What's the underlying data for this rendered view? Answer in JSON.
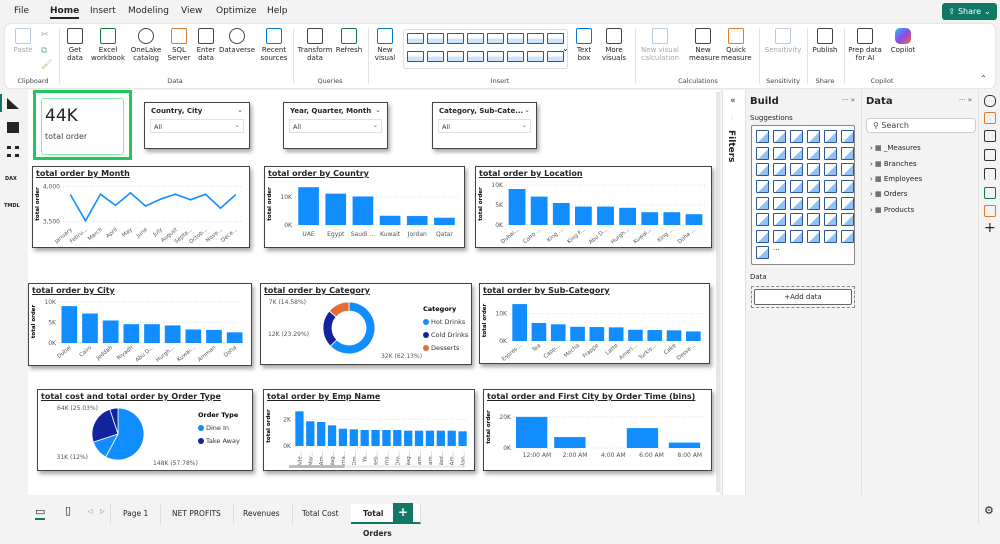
{
  "menu": {
    "file": "File",
    "home": "Home",
    "insert": "Insert",
    "modeling": "Modeling",
    "view": "View",
    "optimize": "Optimize",
    "help": "Help",
    "share": "Share"
  },
  "ribbon": {
    "paste": "Paste",
    "clipboard": "Clipboard",
    "get_data": "Get data",
    "excel": "Excel workbook",
    "onelake": "OneLake catalog",
    "sql": "SQL Server",
    "enter_data": "Enter data",
    "dataverse": "Dataverse",
    "recent": "Recent sources",
    "data_group": "Data",
    "transform": "Transform data",
    "refresh": "Refresh",
    "queries": "Queries",
    "new_visual": "New visual",
    "text_box": "Text box",
    "more_visuals": "More visuals",
    "insert_group": "Insert",
    "new_visual_calc": "New visual calculation",
    "new_measure": "New measure",
    "quick_measure": "Quick measure",
    "calculations": "Calculations",
    "sensitivity": "Sensitivity",
    "sensitivity_group": "Sensitivity",
    "publish": "Publish",
    "share_group": "Share",
    "prep_ai": "Prep data for AI",
    "copilot": "Copilot",
    "copilot_group": "Copilot"
  },
  "kpi": {
    "value": "44K",
    "label": "total order"
  },
  "slicers": [
    {
      "title": "Country, City",
      "value": "All"
    },
    {
      "title": "Year, Quarter, Month",
      "value": "All"
    },
    {
      "title": "Category, Sub-Cate...",
      "value": "All"
    }
  ],
  "colors": {
    "bar": "#118DFF",
    "navy": "#12239E",
    "orange": "#E66C37",
    "accent": "#117865",
    "kpi_border": "#22C55E"
  },
  "chart_data": [
    {
      "id": "month",
      "type": "line",
      "title": "total order by Month",
      "ylabel": "total order",
      "categories": [
        "January",
        "Febru...",
        "March",
        "April",
        "May",
        "June",
        "July",
        "August",
        "Septe...",
        "Octob...",
        "Nove...",
        "Dece..."
      ],
      "values": [
        3880,
        3510,
        3890,
        3730,
        3910,
        3720,
        3820,
        3890,
        3810,
        3890,
        3690,
        3880
      ],
      "ylim": [
        3450,
        4050
      ],
      "yticks": [
        "3,500",
        "4,000"
      ],
      "ytick_values": [
        3500,
        4000
      ]
    },
    {
      "id": "country",
      "type": "bar",
      "title": "total order by Country",
      "ylabel": "total order",
      "categories": [
        "UAE",
        "Egypt",
        "Saudi ...",
        "Kuwait",
        "Jordan",
        "Qatar"
      ],
      "values": [
        13500,
        11200,
        10200,
        3300,
        3200,
        2600
      ],
      "ylim": [
        0,
        15000
      ],
      "yticks": [
        "0K",
        "10K"
      ],
      "ytick_values": [
        0,
        10000
      ]
    },
    {
      "id": "location",
      "type": "bar",
      "title": "total order by Location",
      "ylabel": "total order",
      "categories": [
        "Dubai...",
        "Cairo ...",
        "King ...",
        "King F...",
        "Abu D...",
        "Hurgh...",
        "Kuwai...",
        "King ...",
        "Doha ..."
      ],
      "values": [
        9000,
        7100,
        5500,
        4600,
        4600,
        4300,
        3200,
        3200,
        2700
      ],
      "ylim": [
        0,
        10500
      ],
      "yticks": [
        "0K",
        "5K",
        "10K"
      ],
      "ytick_values": [
        0,
        5000,
        10000
      ]
    },
    {
      "id": "city",
      "type": "bar",
      "title": "total order by City",
      "ylabel": "total order",
      "categories": [
        "Dubai",
        "Cairo",
        "Jeddah",
        "Riyadh",
        "Abu D...",
        "Hurgh...",
        "Kuwai...",
        "Amman",
        "Doha"
      ],
      "values": [
        9000,
        7200,
        5500,
        4600,
        4600,
        4300,
        3300,
        3200,
        2600
      ],
      "ylim": [
        0,
        10500
      ],
      "yticks": [
        "0K",
        "5K",
        "10K"
      ],
      "ytick_values": [
        0,
        5000,
        10000
      ]
    },
    {
      "id": "category",
      "type": "donut",
      "title": "total order by Category",
      "legend_title": "Category",
      "legend": "right",
      "slices": [
        {
          "name": "Hot Drinks",
          "value": 32,
          "label": "32K (62.13%)",
          "color": "#118DFF"
        },
        {
          "name": "Cold Drinks",
          "value": 12,
          "label": "12K (23.29%)",
          "color": "#12239E"
        },
        {
          "name": "Desserts",
          "value": 7,
          "label": "7K (14.58%)",
          "color": "#E66C37"
        }
      ]
    },
    {
      "id": "subcategory",
      "type": "bar",
      "title": "total order by Sub-Category",
      "ylabel": "total order",
      "categories": [
        "Espres...",
        "Tea",
        "Capp...",
        "Mocha",
        "Frappe",
        "Latte",
        "Ameri...",
        "Turkis...",
        "Cake",
        "Desse..."
      ],
      "values": [
        13500,
        6600,
        6100,
        5200,
        5100,
        5000,
        4100,
        4000,
        3900,
        3500
      ],
      "ylim": [
        0,
        15000
      ],
      "yticks": [
        "0K",
        "10K"
      ],
      "ytick_values": [
        0,
        10000
      ]
    },
    {
      "id": "ordertype",
      "type": "pie",
      "title": "total cost and total order by Order Type",
      "legend_title": "Order Type",
      "legend": "right",
      "slices": [
        {
          "name": "Dine In",
          "value": 148,
          "label": "148K (57.78%)",
          "color": "#118DFF"
        },
        {
          "name": "Dine In",
          "value": 31,
          "label": "31K (12%)",
          "color": "#118DFF"
        },
        {
          "name": "Take Away",
          "value": 64,
          "label": "64K (25.03%)",
          "color": "#12239E"
        },
        {
          "name": "Take Away",
          "value": 13,
          "label": "",
          "color": "#12239E"
        }
      ],
      "legend_items": [
        {
          "name": "Dine In",
          "color": "#118DFF"
        },
        {
          "name": "Take Away",
          "color": "#12239E"
        }
      ]
    },
    {
      "id": "emp",
      "type": "bar",
      "title": "total order by Emp Name",
      "ylabel": "total order",
      "categories": [
        "Ade...",
        "Mar...",
        "Am...",
        "Nag...",
        "Ema...",
        "Om...",
        "Ya...",
        "Heb...",
        "Ema...",
        "Om...",
        "Nag...",
        "Kam...",
        "Sam...",
        "Nad...",
        "Am...",
        "Ran..."
      ],
      "values": [
        2600,
        1850,
        1800,
        1550,
        1300,
        1250,
        1200,
        1200,
        1200,
        1200,
        1150,
        1150,
        1150,
        1150,
        1150,
        1100
      ],
      "ylim": [
        0,
        3000
      ],
      "yticks": [
        "0K",
        "2K"
      ],
      "ytick_values": [
        0,
        2000
      ],
      "rotate_vertical": true
    },
    {
      "id": "ordertime",
      "type": "bar",
      "title": "total order and First City by Order Time (bins)",
      "ylabel": "total order",
      "categories": [
        "12:00 AM",
        "2:00 AM",
        "6:00 AM",
        "8:00 AM"
      ],
      "xticks": [
        "12:00 AM",
        "2:00 AM",
        "4:00 AM",
        "6:00 AM",
        "8:00 AM"
      ],
      "values": [
        20000,
        7000,
        12800,
        3500
      ],
      "ylim": [
        0,
        27000
      ],
      "yticks": [
        "0K",
        "20K"
      ],
      "ytick_values": [
        0,
        20000
      ]
    }
  ],
  "filters": {
    "label": "Filters"
  },
  "build": {
    "title": "Build",
    "suggestions": "Suggestions",
    "data_label": "Data",
    "add_data": "+Add data",
    "visual_icons": [
      "stacked-bar",
      "stacked-column",
      "clustered-bar",
      "clustered-column",
      "100-stacked-bar",
      "100-stacked-column",
      "line",
      "area",
      "stacked-area",
      "100-area",
      "line-stacked-column",
      "line-clustered-column",
      "ribbon",
      "waterfall",
      "funnel",
      "scatter",
      "pie",
      "donut",
      "treemap",
      "map",
      "filled-map",
      "shape-map",
      "azure-map",
      "gauge",
      "card",
      "multi-row-card",
      "new-card",
      "kpi",
      "slicer",
      "table",
      "matrix",
      "r-visual",
      "python-visual",
      "key-influencers",
      "decomposition-tree",
      "qa",
      "smart-narrative",
      "metrics",
      "paginated-report",
      "power-apps",
      "power-automate",
      "power-automate-2",
      "arcgis-map",
      "more"
    ]
  },
  "data_pane": {
    "title": "Data",
    "search_placeholder": "Search",
    "tables": [
      "_Measures",
      "Branches",
      "Employees",
      "Orders",
      "Products"
    ]
  },
  "tabs": {
    "pages": [
      "Page 1",
      "NET PROFITS",
      "Revenues",
      "Total Cost",
      "Total Orders"
    ],
    "active": "Total Orders",
    "add": "+"
  }
}
